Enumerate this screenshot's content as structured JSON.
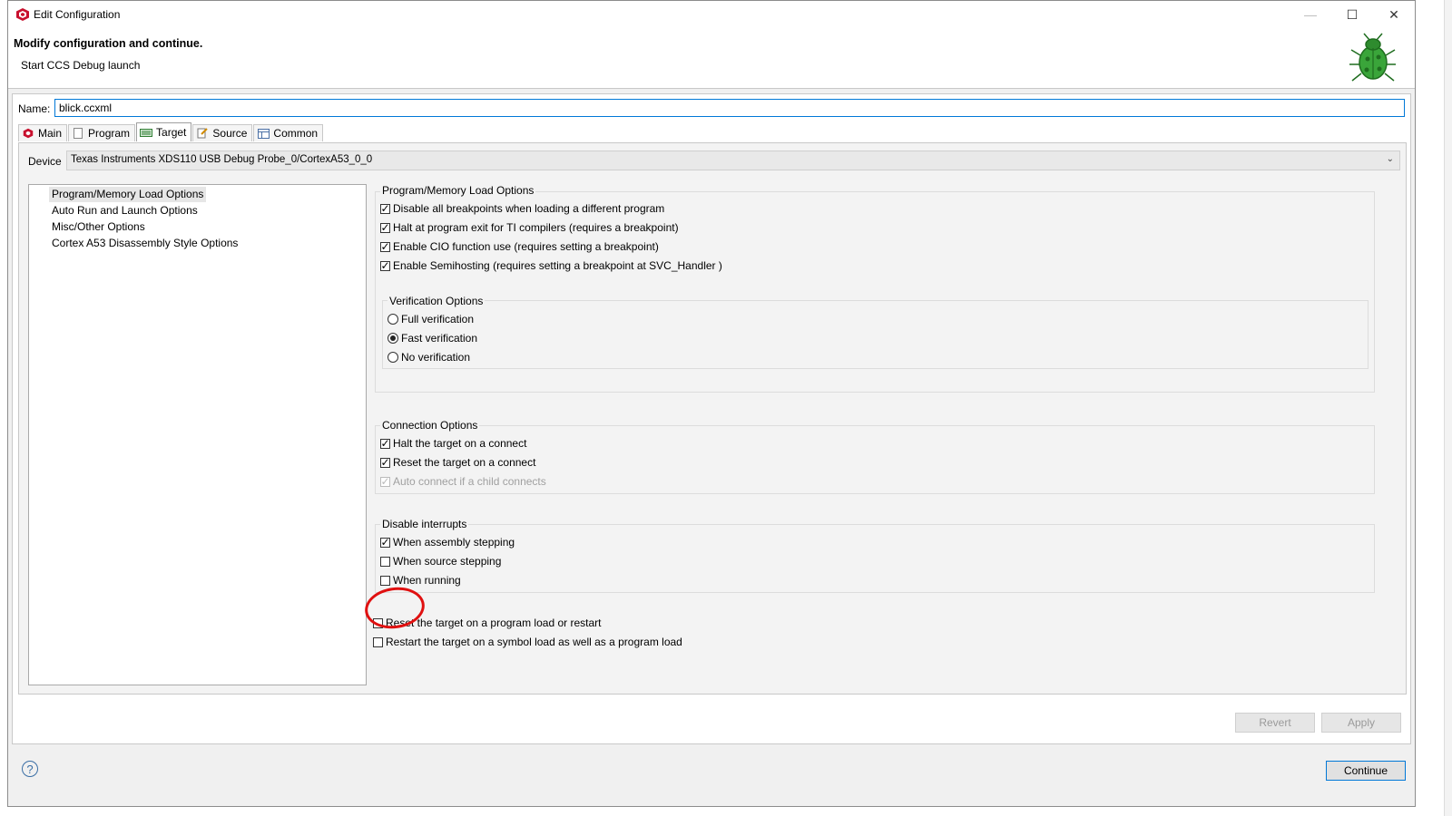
{
  "window": {
    "title": "Edit Configuration",
    "controls": {
      "minimize": "—",
      "maximize": "☐",
      "close": "✕"
    }
  },
  "banner": {
    "title": "Modify configuration and continue.",
    "subtitle": "Start CCS Debug launch",
    "icon": "bug-icon"
  },
  "name_field": {
    "label": "Name:",
    "value": "blick.ccxml"
  },
  "tabs": [
    {
      "label": "Main",
      "icon": "cube-icon"
    },
    {
      "label": "Program",
      "icon": "page-icon"
    },
    {
      "label": "Target",
      "icon": "chip-icon",
      "active": true
    },
    {
      "label": "Source",
      "icon": "source-icon"
    },
    {
      "label": "Common",
      "icon": "table-icon"
    }
  ],
  "device": {
    "label": "Device",
    "value": "Texas Instruments XDS110 USB Debug Probe_0/CortexA53_0_0"
  },
  "tree": [
    {
      "label": "Program/Memory Load Options",
      "selected": true
    },
    {
      "label": "Auto Run and Launch Options"
    },
    {
      "label": "Misc/Other Options"
    },
    {
      "label": "Cortex A53 Disassembly Style Options"
    }
  ],
  "program_memory": {
    "title": "Program/Memory Load Options",
    "options": [
      {
        "label": "Disable all breakpoints when loading a different program",
        "checked": true
      },
      {
        "label": "Halt at program exit for TI compilers (requires a breakpoint)",
        "checked": true
      },
      {
        "label": "Enable CIO function use (requires setting a breakpoint)",
        "checked": true
      },
      {
        "label": "Enable Semihosting (requires setting a breakpoint at SVC_Handler )",
        "checked": true
      }
    ]
  },
  "verification": {
    "title": "Verification Options",
    "options": [
      {
        "label": "Full verification",
        "selected": false
      },
      {
        "label": "Fast verification",
        "selected": true
      },
      {
        "label": "No verification",
        "selected": false
      }
    ]
  },
  "connection": {
    "title": "Connection Options",
    "options": [
      {
        "label": "Halt the target on a connect",
        "checked": true
      },
      {
        "label": "Reset the target on a connect",
        "checked": true
      },
      {
        "label": "Auto connect if a child connects",
        "checked": true,
        "disabled": true
      }
    ]
  },
  "interrupts": {
    "title": "Disable interrupts",
    "options": [
      {
        "label": "When assembly stepping",
        "checked": true
      },
      {
        "label": "When source stepping",
        "checked": false
      },
      {
        "label": "When running",
        "checked": false
      }
    ]
  },
  "extra_options": [
    {
      "label": "Reset the target on a program load or restart",
      "checked": false
    },
    {
      "label": "Restart the target on a symbol load as well as a program load",
      "checked": false
    }
  ],
  "buttons": {
    "revert": "Revert",
    "apply": "Apply",
    "continue": "Continue",
    "help": "?"
  },
  "colors": {
    "accent": "#0078d7",
    "annotation": "#e01010"
  }
}
